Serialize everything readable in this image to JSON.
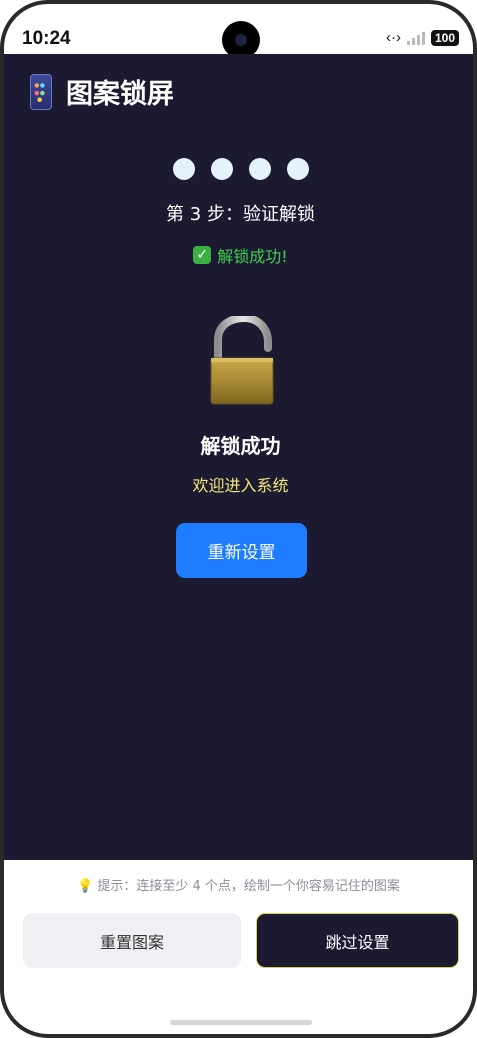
{
  "status_bar": {
    "time": "10:24",
    "battery": "100"
  },
  "header": {
    "app_icon": "phone-icon",
    "title": "图案锁屏"
  },
  "progress": {
    "dots_filled": 4,
    "dots_total": 4
  },
  "step": {
    "text": "第 3 步：验证解锁"
  },
  "status": {
    "icon": "check-icon",
    "text": "解锁成功!"
  },
  "lock": {
    "icon": "unlocked-padlock-icon",
    "label": "解锁成功",
    "welcome": "欢迎进入系统"
  },
  "actions": {
    "reset_label": "重新设置"
  },
  "footer": {
    "hint_icon": "bulb-icon",
    "hint": "提示：连接至少 4 个点，绘制一个你容易记住的图案",
    "reset_pattern_label": "重置图案",
    "skip_label": "跳过设置"
  },
  "colors": {
    "app_background": "#1b1a31",
    "accent_blue": "#1e7cff",
    "success_green": "#3fcf4d",
    "welcome_yellow": "#f2e77a"
  }
}
